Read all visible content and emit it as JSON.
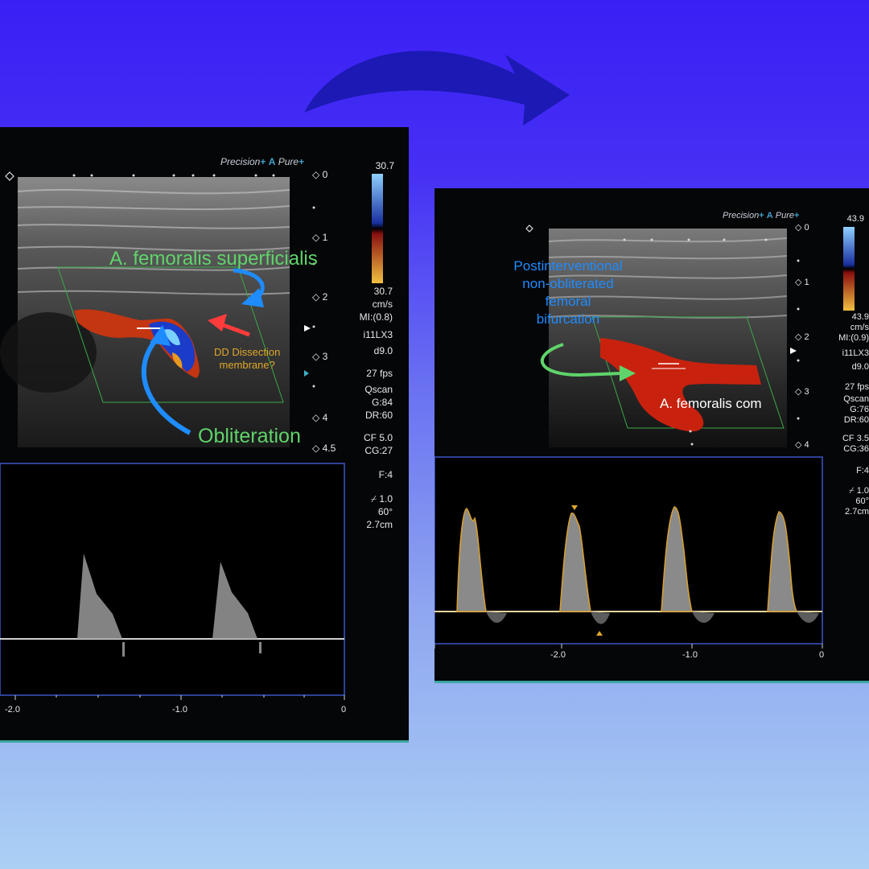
{
  "left": {
    "brand_prefix": "Precision",
    "brand_mid": "A",
    "brand_suffix": "Pure",
    "scale_top": "30.7",
    "scale_bottom": "30.7",
    "scale_unit": "cm/s",
    "mi": "MI:(0.8)",
    "probe": "i11LX3",
    "depth_setting": "d9.0",
    "fps": "27 fps",
    "qscan": "Qscan",
    "gain": "G:84",
    "dr": "DR:60",
    "cf": "CF 5.0",
    "cg": "CG:27",
    "focus": "F:4",
    "steer_size": "1.0",
    "steer_angle": "60°",
    "gate": "2.7cm",
    "depth_marks": [
      "0",
      "1",
      "2",
      "3",
      "4",
      "4.5"
    ],
    "time_ticks": [
      "-2.0",
      "-1.0",
      "0"
    ],
    "label_sfa": "A. femoralis superficialis",
    "label_dd": "DD Dissection\nmembrane?",
    "label_obliteration": "Obliteration"
  },
  "right": {
    "brand_prefix": "Precision",
    "brand_mid": "A",
    "brand_suffix": "Pure",
    "scale_top": "43.9",
    "scale_bottom": "43.9",
    "scale_unit": "cm/s",
    "mi": "MI:(0.9)",
    "probe": "i11LX3",
    "depth_setting": "d9.0",
    "fps": "27 fps",
    "qscan": "Qscan",
    "gain": "G:76",
    "dr": "DR:60",
    "cf": "CF 3.5",
    "cg": "CG:36",
    "focus": "F:4",
    "steer_size": "1.0",
    "steer_angle": "60°",
    "gate": "2.7cm",
    "depth_marks": [
      "0",
      "1",
      "2",
      "3",
      "4"
    ],
    "time_ticks": [
      "-2.0",
      "-1.0",
      "0"
    ],
    "label_post": "Postinterventional\nnon-obliterated\nfemoral\nbifurcation",
    "label_com": "A. femoralis com"
  },
  "colors": {
    "annotation_green": "#5fd46a",
    "annotation_blue": "#1e8cff",
    "annotation_red": "#ff3b3b",
    "annotation_orange": "#e0a82a",
    "transition_arrow": "#1a18b0"
  }
}
